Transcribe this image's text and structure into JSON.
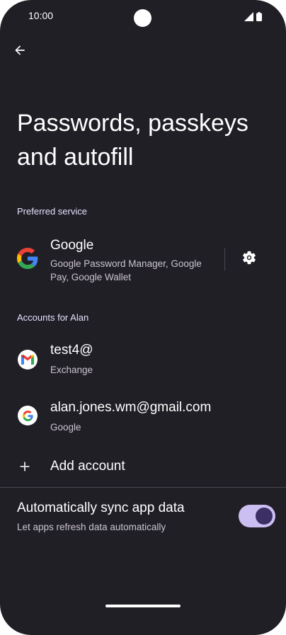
{
  "status_bar": {
    "time": "10:00"
  },
  "header": {
    "back_icon": "arrow-left-icon",
    "title": "Passwords, passkeys and autofill"
  },
  "preferred_service": {
    "header": "Preferred service",
    "name": "Google",
    "description": "Google Password Manager, Google Pay, Google Wallet",
    "icon": "google-g-logo",
    "settings_icon": "gear-icon"
  },
  "accounts": {
    "header": "Accounts for Alan",
    "items": [
      {
        "name": "test4@",
        "type": "Exchange",
        "icon": "gmail-icon"
      },
      {
        "name": "alan.jones.wm@gmail.com",
        "type": "Google",
        "icon": "google-g-logo"
      }
    ],
    "add_label": "Add account",
    "add_icon": "plus-icon"
  },
  "sync": {
    "title": "Automatically sync app data",
    "subtitle": "Let apps refresh data automatically",
    "enabled": true
  },
  "colors": {
    "background": "#211f26",
    "toggle_track": "#cbbff2",
    "toggle_knob": "#3b2f66",
    "divider": "#49454f"
  }
}
